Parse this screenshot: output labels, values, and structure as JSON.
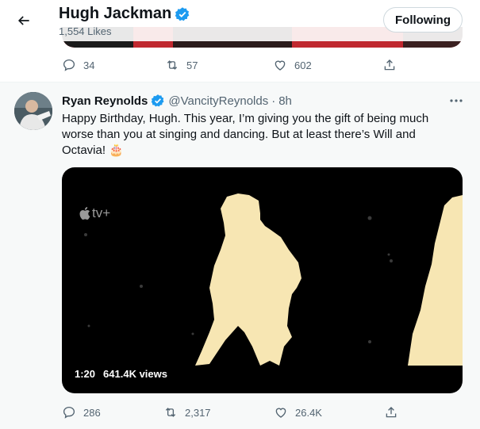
{
  "header": {
    "title": "Hugh Jackman",
    "likes": "1,554 Likes",
    "follow_label": "Following"
  },
  "prev_tweet": {
    "replies": "34",
    "retweets": "57",
    "likes": "602"
  },
  "tweet": {
    "name": "Ryan Reynolds",
    "handle": "@VancityReynolds",
    "separator": "·",
    "time": "8h",
    "text": "Happy Birthday, Hugh. This year, I’m giving you the gift of being much worse than you at singing and dancing. But at least there’s Will and Octavia! 🎂",
    "video": {
      "watermark": "tv+",
      "duration": "1:20",
      "views": "641.4K views"
    },
    "replies": "286",
    "retweets": "2,317",
    "likes": "26.4K"
  },
  "colors": {
    "verified": "#1d9bf0",
    "text_secondary": "#536471",
    "follow_border": "#cfd9de"
  },
  "icons": [
    "back-arrow-icon",
    "verified-badge-icon",
    "reply-icon",
    "retweet-icon",
    "like-icon",
    "share-icon",
    "more-icon",
    "apple-logo-icon"
  ]
}
